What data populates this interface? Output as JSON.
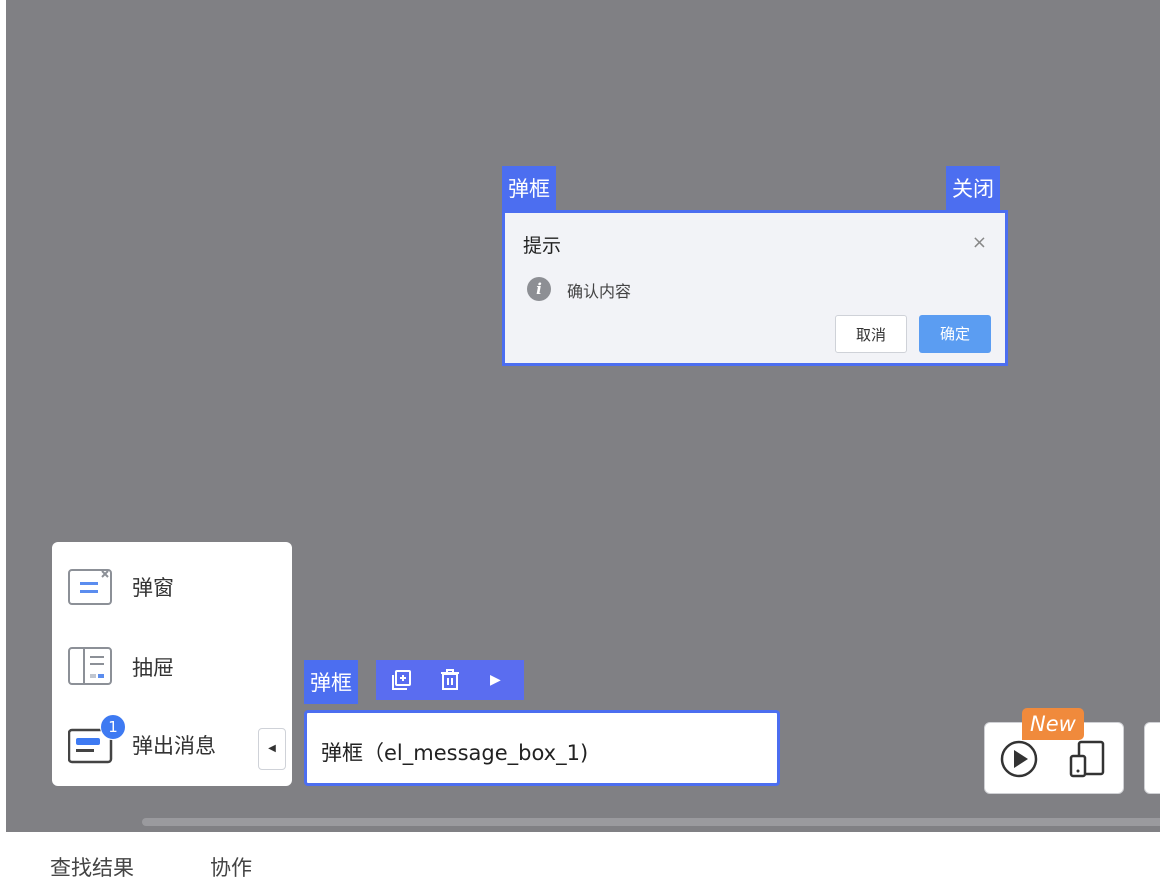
{
  "dialog": {
    "tag_label": "弹框",
    "close_tag_label": "关闭",
    "title": "提示",
    "close_icon": "×",
    "message": "确认内容",
    "cancel_label": "取消",
    "ok_label": "确定"
  },
  "panel": {
    "items": [
      {
        "label": "弹窗",
        "icon": "popup-window-icon"
      },
      {
        "label": "抽屉",
        "icon": "drawer-icon"
      },
      {
        "label": "弹出消息",
        "icon": "popup-message-icon",
        "badge": "1"
      }
    ],
    "collapse_icon": "◀"
  },
  "component": {
    "tag_label": "弹框",
    "label": "弹框（el_message_box_1)",
    "toolbar": {
      "play_icon": "▶"
    }
  },
  "preview": {
    "new_badge": "New"
  },
  "bottom_tabs": [
    "查找结果",
    "协作"
  ],
  "colors": {
    "canvas": "#808084",
    "accent": "#4c6ef0",
    "primary_button": "#5b9df2",
    "new_badge": "#f08a3c"
  }
}
